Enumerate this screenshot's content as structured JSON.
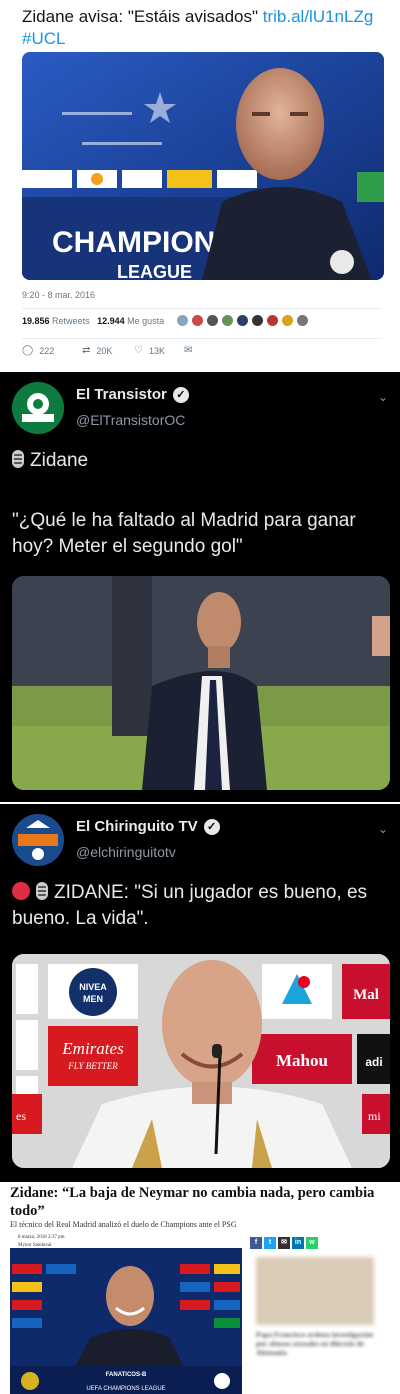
{
  "tweet1": {
    "text": "Zidane avisa: \"Estáis avisados\" ",
    "link": "trib.al/lU1nLZg",
    "hashtag": "#UCL",
    "backdrop_text": "CHAMPIONS",
    "backdrop_text2": "LEAGUE",
    "timestamp": "9:20 - 8 mar. 2016",
    "retweets_count": "19.856",
    "retweets_label": "Retweets",
    "likes_count": "12.944",
    "likes_label": "Me gusta",
    "reply_count": "222",
    "retweet_action_count": "20K",
    "like_action_count": "13K",
    "colors": {
      "link": "#1b95e0",
      "backdrop": "#1d3f8f"
    }
  },
  "tweet2": {
    "account_name": "El Transistor",
    "handle": "@ElTransistorOC",
    "line1": "Zidane",
    "quote": "\"¿Qué le ha faltado al Madrid para ganar hoy? Meter el segundo gol\""
  },
  "tweet3": {
    "account_name": "El Chiringuito TV",
    "handle": "@elchiringuitotv",
    "quote": "ZIDANE: \"Si un jugador es bueno, es bueno. La vida\".",
    "sponsor_logos": [
      "NIVEA",
      "MEN",
      "Emirates",
      "FLY BETTER",
      "Mal",
      "Mahou",
      "adi",
      "es",
      "mi"
    ]
  },
  "article": {
    "headline": "Zidane: “La baja de Neymar no cambia nada, pero cambia todo”",
    "subheadline": "El técnico del Real Madrid analizó el duelo de Champions ante el PSG",
    "date": "8 marzo, 2018 2:37 pm",
    "author": "Mynor Sandoval",
    "share_buttons": [
      "f",
      "t",
      "✉",
      "in",
      "w"
    ],
    "photo_caption": "FANATICOS-B",
    "photo_banner": "UEFA CHAMPIONS LEAGUE",
    "side_headline": "Papa Francisco ordena investigación por abusos sexuales en diócesis de Alemania"
  }
}
